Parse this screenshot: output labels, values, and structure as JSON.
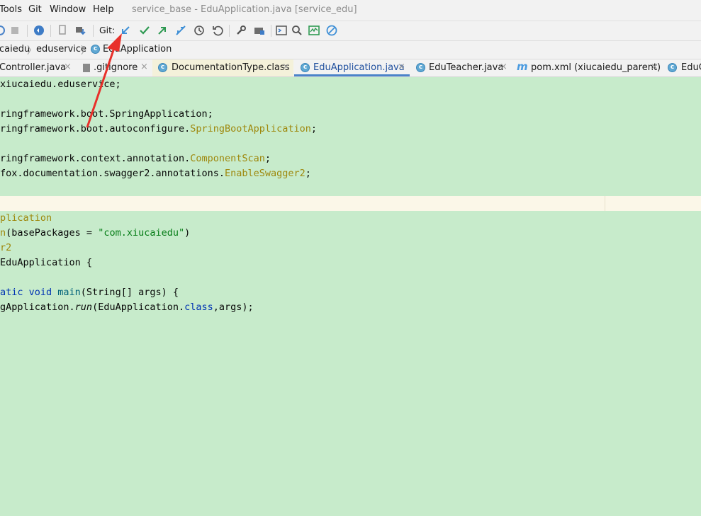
{
  "menubar": {
    "items": [
      "Tools",
      "Git",
      "Window",
      "Help"
    ],
    "window_title": "service_base - EduApplication.java [service_edu]"
  },
  "toolbar": {
    "git_label": "Git:",
    "icons": [
      "run-icon",
      "stop-icon",
      "coverage-icon",
      "device-icon",
      "deploy-icon",
      "git-update-icon",
      "git-commit-icon",
      "git-push-icon",
      "git-merge-icon",
      "history-icon",
      "rollback-icon",
      "wrench-icon",
      "project-structure-icon",
      "terminal-icon",
      "search-icon",
      "monitor-icon",
      "no-entry-icon"
    ]
  },
  "breadcrumb": {
    "items": [
      "caiedu",
      "eduservice",
      "EduApplication"
    ]
  },
  "tabs": [
    {
      "label": "Controller.java",
      "icon": "class-icon"
    },
    {
      "label": ".gitignore",
      "icon": "file-icon"
    },
    {
      "label": "DocumentationType.class",
      "icon": "class-icon"
    },
    {
      "label": "EduApplication.java",
      "icon": "class-icon",
      "active": true
    },
    {
      "label": "EduTeacher.java",
      "icon": "class-icon"
    },
    {
      "label": "pom.xml (xiucaiedu_parent)",
      "icon": "maven-icon"
    },
    {
      "label": "EduC",
      "icon": "class-icon"
    }
  ],
  "tab_close": "×",
  "code": {
    "l1": "xiucaiedu.eduservice;",
    "l3": "ringframework.boot.SpringApplication;",
    "l4a": "ringframework.boot.autoconfigure.",
    "l4b": "SpringBootApplication",
    "l4c": ";",
    "l6a": "ringframework.context.annotation.",
    "l6b": "ComponentScan",
    "l6c": ";",
    "l7a": "fox.documentation.swagger2.annotations.",
    "l7b": "EnableSwagger2",
    "l7c": ";",
    "l10": "plication",
    "l11a": "n",
    "l11b": "(basePackages = ",
    "l11c": "\"com.xiucaiedu\"",
    "l11d": ")",
    "l12": "r2",
    "l13": "EduApplication {",
    "l15a": "atic void ",
    "l15b": "main",
    "l15c": "(String[] args) {",
    "l16a": "gApplication.",
    "l16b": "run",
    "l16c": "(EduApplication.",
    "l16d": "class",
    "l16e": ",args);"
  },
  "colors": {
    "accent": "#4a83c9",
    "editor_bg": "#c7ebcb",
    "arrow": "#e8302a"
  }
}
